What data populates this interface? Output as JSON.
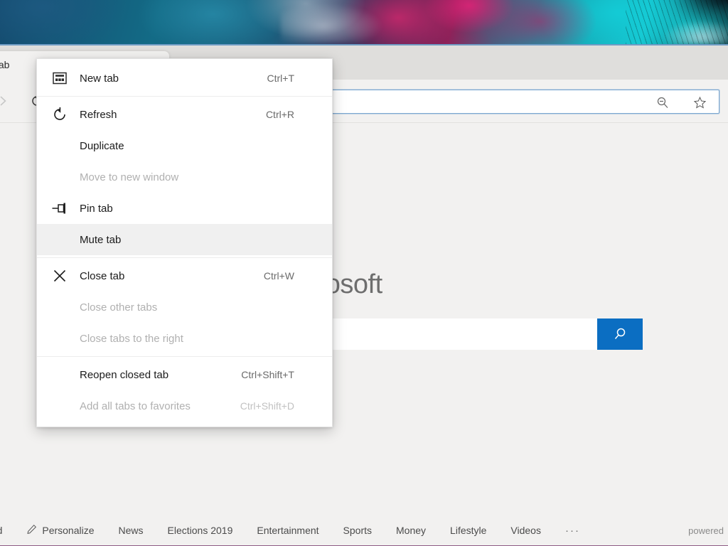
{
  "desktop": {
    "wallpaper_name": "abstract-smoke-wallpaper"
  },
  "browser": {
    "tab": {
      "title": "tab",
      "icon": "tab-favicon"
    },
    "toolbar": {
      "forward_icon": "forward-arrow-icon",
      "refresh_icon": "refresh-icon",
      "address_value": "",
      "address_placeholder": "",
      "zoom_out_icon": "zoom-out-icon",
      "favorite_icon": "star-icon"
    }
  },
  "context_menu": {
    "items": [
      {
        "label": "New tab",
        "shortcut": "Ctrl+T",
        "icon": "new-tab-icon",
        "state": "enabled",
        "name": "menu-item-new-tab"
      },
      {
        "type": "separator",
        "name": "menu-separator-1"
      },
      {
        "label": "Refresh",
        "shortcut": "Ctrl+R",
        "icon": "refresh-icon",
        "state": "enabled",
        "name": "menu-item-refresh"
      },
      {
        "label": "Duplicate",
        "shortcut": "",
        "icon": "",
        "state": "enabled",
        "name": "menu-item-duplicate"
      },
      {
        "label": "Move to new window",
        "shortcut": "",
        "icon": "",
        "state": "disabled",
        "name": "menu-item-move-to-new-window"
      },
      {
        "label": "Pin tab",
        "shortcut": "",
        "icon": "pin-icon",
        "state": "enabled",
        "name": "menu-item-pin-tab"
      },
      {
        "label": "Mute tab",
        "shortcut": "",
        "icon": "",
        "state": "highlighted",
        "name": "menu-item-mute-tab"
      },
      {
        "type": "separator",
        "name": "menu-separator-2"
      },
      {
        "label": "Close tab",
        "shortcut": "Ctrl+W",
        "icon": "close-x-icon",
        "state": "enabled",
        "name": "menu-item-close-tab"
      },
      {
        "label": "Close other tabs",
        "shortcut": "",
        "icon": "",
        "state": "disabled",
        "name": "menu-item-close-other-tabs"
      },
      {
        "label": "Close tabs to the right",
        "shortcut": "",
        "icon": "",
        "state": "disabled",
        "name": "menu-item-close-tabs-to-the-right"
      },
      {
        "type": "separator",
        "name": "menu-separator-3"
      },
      {
        "label": "Reopen closed tab",
        "shortcut": "Ctrl+Shift+T",
        "icon": "",
        "state": "enabled",
        "name": "menu-item-reopen-closed-tab"
      },
      {
        "label": "Add all tabs to favorites",
        "shortcut": "Ctrl+Shift+D",
        "icon": "",
        "state": "disabled",
        "name": "menu-item-add-all-tabs-to-favorites"
      }
    ]
  },
  "page": {
    "brand": {
      "wordmark": "Microsoft",
      "logo_colors": [
        "#f25022",
        "#7fba00",
        "#00a4ef",
        "#ffb900"
      ]
    },
    "search": {
      "value": "",
      "placeholder": "",
      "button_icon": "search-icon",
      "button_color": "#0b6ec2"
    },
    "bottom_nav": {
      "links": [
        {
          "label": "eed",
          "icon": ""
        },
        {
          "label": "Personalize",
          "icon": "pencil-icon"
        },
        {
          "label": "News",
          "icon": ""
        },
        {
          "label": "Elections 2019",
          "icon": ""
        },
        {
          "label": "Entertainment",
          "icon": ""
        },
        {
          "label": "Sports",
          "icon": ""
        },
        {
          "label": "Money",
          "icon": ""
        },
        {
          "label": "Lifestyle",
          "icon": ""
        },
        {
          "label": "Videos",
          "icon": ""
        }
      ],
      "overflow": "···",
      "powered_label": "powered",
      "accent_color": "#8d5b84"
    }
  }
}
